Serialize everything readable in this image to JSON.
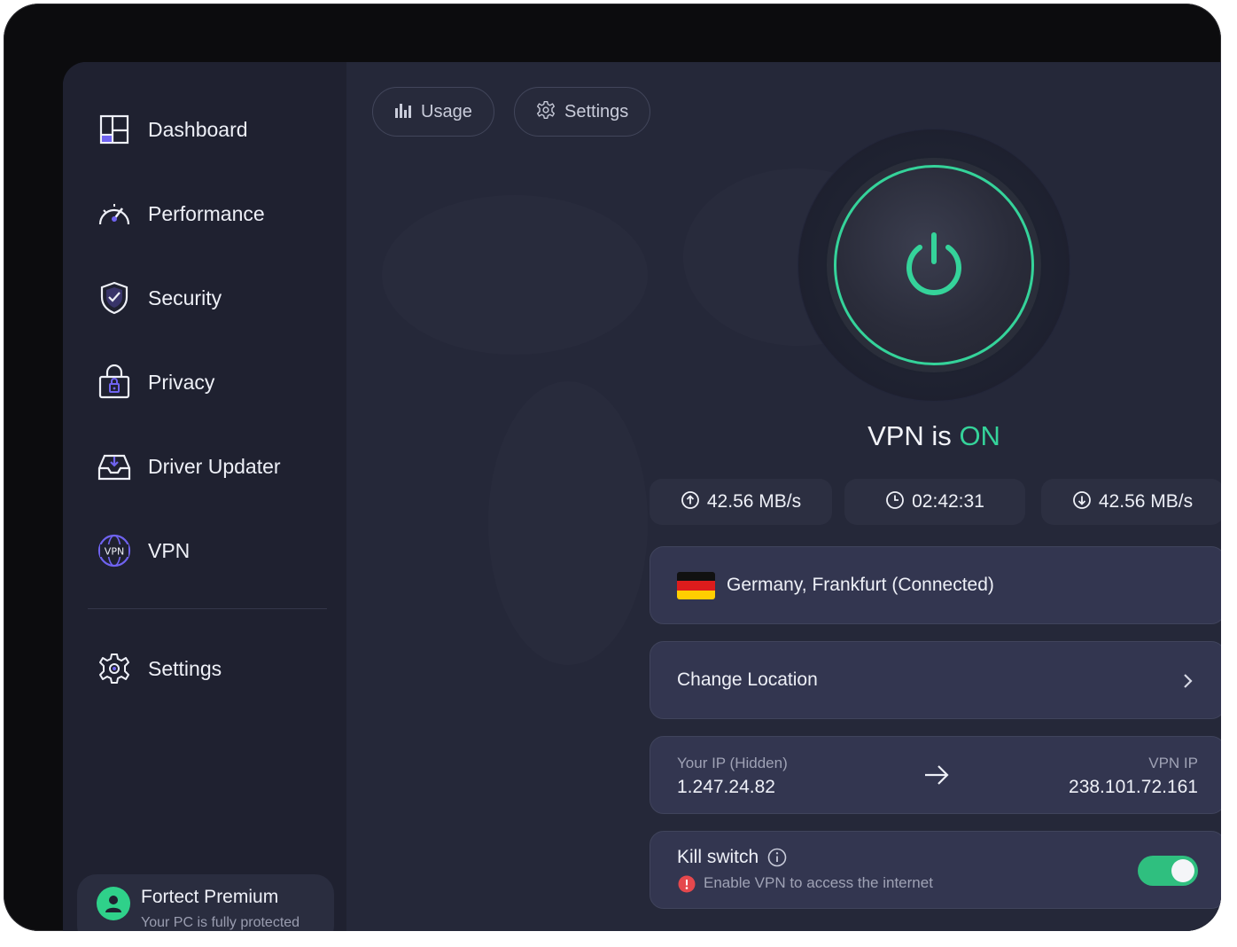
{
  "sidebar": {
    "items": [
      {
        "label": "Dashboard",
        "icon": "dashboard-icon"
      },
      {
        "label": "Performance",
        "icon": "speedometer-icon"
      },
      {
        "label": "Security",
        "icon": "shield-icon"
      },
      {
        "label": "Privacy",
        "icon": "lock-bag-icon"
      },
      {
        "label": "Driver Updater",
        "icon": "driver-download-icon"
      },
      {
        "label": "VPN",
        "icon": "vpn-globe-icon"
      }
    ],
    "settings_label": "Settings",
    "premium": {
      "title": "Fortect Premium",
      "subtitle": "Your PC is fully protected"
    }
  },
  "top_tabs": {
    "usage_label": "Usage",
    "settings_label": "Settings"
  },
  "vpn": {
    "status_prefix": "VPN is",
    "status_value": "ON",
    "upload": "42.56 MB/s",
    "duration": "02:42:31",
    "download": "42.56 MB/s",
    "location": "Germany, Frankfurt (Connected)",
    "change_location_label": "Change Location",
    "your_ip_label": "Your IP (Hidden)",
    "your_ip": "1.247.24.82",
    "vpn_ip_label": "VPN IP",
    "vpn_ip": "238.101.72.161",
    "kill_switch_label": "Kill switch",
    "kill_switch_note": "Enable VPN to access the internet",
    "kill_switch_on": true
  },
  "colors": {
    "accent": "#35d39a",
    "sidebar_bg": "#1f2130",
    "main_bg": "#252839",
    "card_bg": "#333650",
    "warning": "#e5484d",
    "icon_violet": "#6f63f0"
  }
}
